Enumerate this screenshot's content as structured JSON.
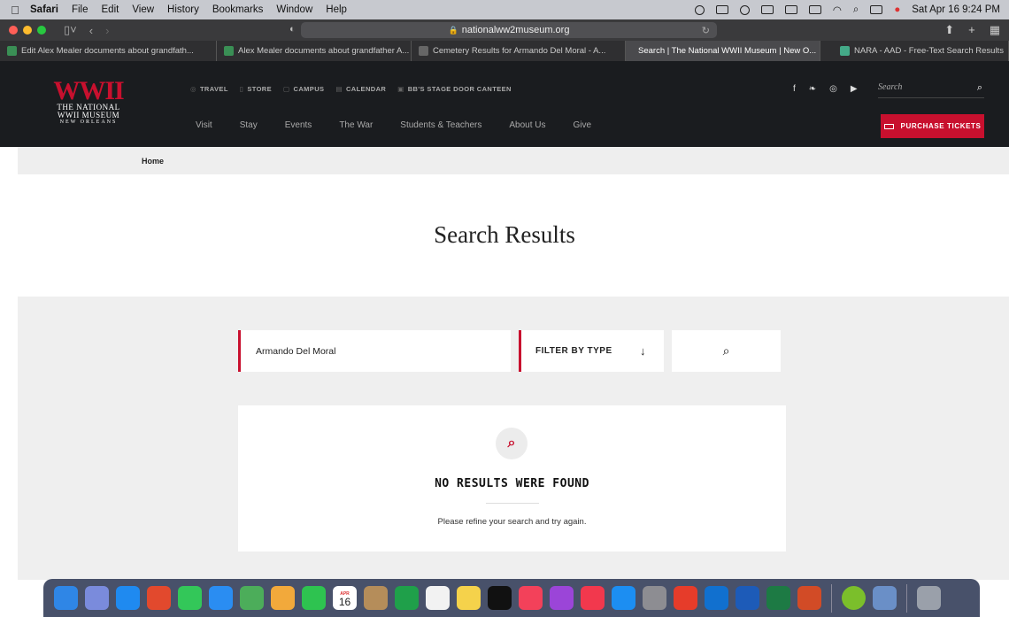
{
  "menubar": {
    "app": "Safari",
    "items": [
      "File",
      "Edit",
      "View",
      "History",
      "Bookmarks",
      "Window",
      "Help"
    ],
    "datetime": "Sat Apr 16  9:24 PM"
  },
  "browser": {
    "url": "nationalww2museum.org",
    "tabs": [
      {
        "title": "Edit Alex Mealer documents about grandfath...",
        "fav_color": "#3a8f55"
      },
      {
        "title": "Alex Mealer documents about grandfather A...",
        "fav_color": "#3a8f55"
      },
      {
        "title": "Cemetery Results for Armando Del Moral - A...",
        "fav_color": "#444"
      },
      {
        "title": "Search | The National WWII Museum | New O...",
        "fav_color": "#333"
      },
      {
        "title": "NARA - AAD - Free-Text Search Results",
        "fav_color": "#4a8"
      }
    ]
  },
  "site": {
    "logo": {
      "ww": "WW",
      "roman": "II",
      "line1": "THE NATIONAL",
      "line2": "WWII MUSEUM",
      "line3": "NEW ORLEANS"
    },
    "utility": [
      "TRAVEL",
      "STORE",
      "CAMPUS",
      "CALENDAR",
      "BB'S STAGE DOOR CANTEEN"
    ],
    "search_placeholder": "Search",
    "nav": [
      "Visit",
      "Stay",
      "Events",
      "The War",
      "Students & Teachers",
      "About Us",
      "Give"
    ],
    "purchase": "PURCHASE TICKETS"
  },
  "breadcrumb": "Home",
  "page_title": "Search Results",
  "search": {
    "value": "Armando Del Moral",
    "filter_label": "FILTER BY TYPE"
  },
  "no_results": {
    "heading": "NO RESULTS WERE FOUND",
    "message": "Please refine your search and try again."
  },
  "dock": {
    "calendar_month": "APR",
    "calendar_day": "16",
    "apps": [
      {
        "name": "finder",
        "color": "#2f86e6"
      },
      {
        "name": "launchpad",
        "color": "#7a8bdc"
      },
      {
        "name": "safari",
        "color": "#1f8af0"
      },
      {
        "name": "chrome",
        "color": "#e2492d"
      },
      {
        "name": "messages",
        "color": "#33c759"
      },
      {
        "name": "mail",
        "color": "#2a8df2"
      },
      {
        "name": "maps",
        "color": "#4cad5a"
      },
      {
        "name": "photos",
        "color": "#f2a93b"
      },
      {
        "name": "facetime",
        "color": "#2ec350"
      },
      {
        "name": "calendar",
        "color": "#ffffff"
      },
      {
        "name": "contacts",
        "color": "#b58d5a"
      },
      {
        "name": "numbers",
        "color": "#1fa04a"
      },
      {
        "name": "reminders",
        "color": "#f2f2f2"
      },
      {
        "name": "notes",
        "color": "#f5d24b"
      },
      {
        "name": "tv",
        "color": "#111111"
      },
      {
        "name": "music",
        "color": "#f3415a"
      },
      {
        "name": "podcasts",
        "color": "#9b45d8"
      },
      {
        "name": "news",
        "color": "#f2384d"
      },
      {
        "name": "app-store",
        "color": "#1c8ef2"
      },
      {
        "name": "system-preferences",
        "color": "#8d8d92"
      },
      {
        "name": "pdf",
        "color": "#e63c2a"
      },
      {
        "name": "outlook",
        "color": "#1170cf"
      },
      {
        "name": "word",
        "color": "#1d5bb8"
      },
      {
        "name": "excel",
        "color": "#1d7a44"
      },
      {
        "name": "powerpoint",
        "color": "#d24b26"
      },
      {
        "name": "wyzant",
        "color": "#7bbf2b"
      },
      {
        "name": "preview",
        "color": "#6a8fc7"
      },
      {
        "name": "trash",
        "color": "#9aa0aa"
      }
    ]
  },
  "colors": {
    "accent": "#c8102e",
    "header_bg": "#1a1c1f"
  }
}
